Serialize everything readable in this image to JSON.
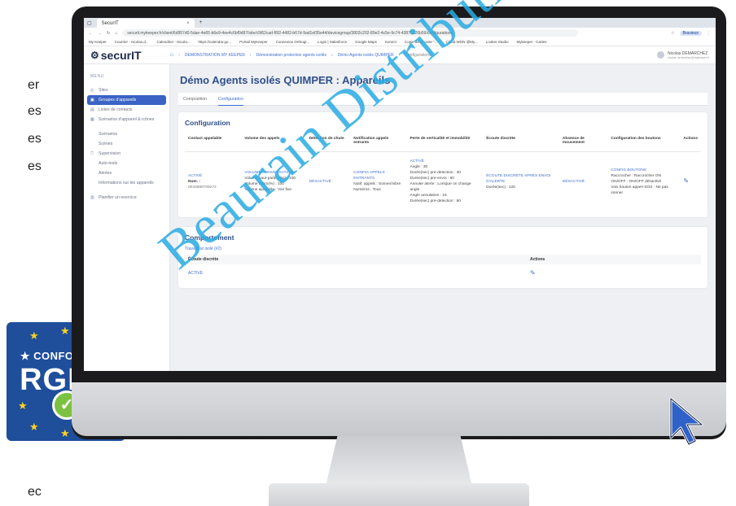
{
  "edge_text": [
    "er",
    "es",
    "es",
    "es",
    "ec"
  ],
  "badge": {
    "line1": "★ CONFORME ★",
    "line2": "RGPD",
    "check": "✓"
  },
  "browser": {
    "tab_title": "SecurIT",
    "tab_close": "×",
    "tab_add": "+",
    "url": "securit.mykeeper.fr/client/6d957d0-5dae-4e65-b6e9-4ee4c6bf9d97/site/c5f62cad-f6f2-4482-b67d-9ad1ef35e44/devicegroup/3802c202-89e2-4c5e-9c74-43873126b59/configurations",
    "bookmarks": [
      "My Keeper",
      "Courrier - nicolas.d...",
      "Calendrier - Nicola...",
      "https://calendar.go...",
      "Portail MyKeeper",
      "Connexion Orthogr...",
      "Login | Salesforce",
      "Google Maps",
      "Konect",
      "Copie de la carte \"...",
      "Cloud WON @My...",
      "Looker Studio",
      "Mykeeper - Cartes"
    ],
    "profile_label": "Bravieux"
  },
  "app": {
    "logo": "securIT",
    "breadcrumb": [
      "DEMONSTRATION MY KEEPER",
      "Démonstration protection agents isolés",
      "Démo Agents isolés QUIMPER",
      "Configurations"
    ],
    "user_name": "Nicolas DEMARCHEZ",
    "user_sub": "nicolas.demarchez@mykeeper.fr"
  },
  "sidebar": {
    "menu_label": "MENU",
    "items": [
      {
        "label": "Sites",
        "icon": "◎"
      },
      {
        "label": "Groupes d'appareils",
        "icon": "▣"
      },
      {
        "label": "Listes de contacts",
        "icon": "▤"
      },
      {
        "label": "Scénarios d'appareil & icônes",
        "icon": "▦"
      },
      {
        "label": "Scénarios",
        "icon": ""
      },
      {
        "label": "Scènes",
        "icon": ""
      },
      {
        "label": "Supervision",
        "icon": "⛉"
      },
      {
        "label": "Auto-tests",
        "icon": ""
      },
      {
        "label": "Alertes",
        "icon": ""
      },
      {
        "label": "Informations sur les appareils",
        "icon": ""
      },
      {
        "label": "Planifier un exercice",
        "icon": "▥"
      }
    ]
  },
  "page": {
    "title": "Démo Agents isolés QUIMPER : Appareils",
    "tabs": [
      "Composition",
      "Configuration"
    ]
  },
  "configuration": {
    "title": "Configuration",
    "headers": [
      "Contact appelable",
      "Volume des appels",
      "Détection de chute",
      "Notification appels entrants",
      "Perte de verticalité et immobilité",
      "Écoute discrète",
      "Absence de mouvement",
      "Configuration des boutons",
      "Actions"
    ],
    "contact": {
      "status": "ACTIVÉ",
      "num_label": "Num. :",
      "num_value": "0033688708272"
    },
    "volume": {
      "head": "VOLUME CONVERSATION",
      "l1": "Volume haut-parleur(%) : 100",
      "l2": "Volume micro(%) : 100",
      "l3": "Volume ajustable : Voir fixe"
    },
    "chute": "DÉSACTIVÉ",
    "notif": {
      "head": "CONFIG APPELS ENTRANTS",
      "l1": "Notif. appels : Sonner/vibre",
      "l2": "Numéros : Tous"
    },
    "perte": {
      "head": "ACTIVÉ",
      "l1": "Angle : 30",
      "l2": "Durée(sec) pre-detection : 30",
      "l3": "Durée(sec) pre-envoi : 60",
      "l4": "Annuler alerte : Lorsque on change angle",
      "l5": "Angle annulation : 15",
      "l6": "Durée(sec) pre-detection : 60"
    },
    "ecoute": {
      "head": "ÉCOUTE DISCRÈTE APRÈS ENVOI D'ALERTE",
      "l1": "Durée(sec) : 120"
    },
    "absence": "DÉSACTIVÉ",
    "boutons": {
      "head": "CONFIG BOUTONS",
      "l1": "Raccrocher : Raccrocher ON",
      "l2": "ON/OFF : ON/OFF désactivé",
      "l3": "Voix bouton appel+SOS : Ne pas sonner"
    },
    "action_icon": "✎"
  },
  "comportement": {
    "title": "Comportement",
    "subtitle": "Travailleur isolé (#2)",
    "headers": [
      "Écoute discrète",
      "Actions"
    ],
    "row_status": "ACTIVÉ",
    "action_icon": "✎"
  },
  "watermark": "Beaurain Distribution",
  "colors": {
    "accent": "#3f6fd1",
    "title": "#2f4f8a",
    "sidebar_active": "#3a63c5",
    "badge": "#1f4e9b",
    "watermark": "#29aae2"
  }
}
